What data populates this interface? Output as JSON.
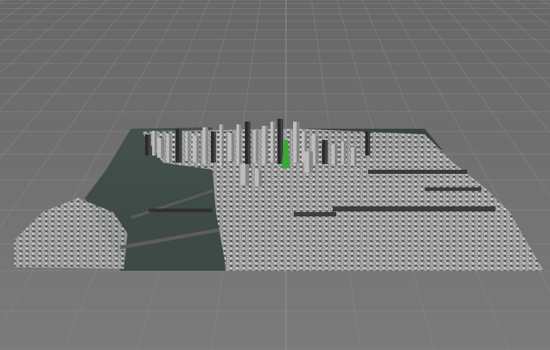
{
  "viewport": {
    "kind": "3d-editor-viewport",
    "background_color": "#6e6e6e",
    "grid_line_color": "#8a8a8a",
    "grid_axis_color": "#9a9a9a"
  },
  "scene": {
    "model": "city-mesh",
    "ground_color": "#3c4a44",
    "water_color": "#3f4b46",
    "building_light_color": "#bdbdbd",
    "building_dark_color": "#2b2b2b",
    "highlight_color": "#38a838"
  }
}
